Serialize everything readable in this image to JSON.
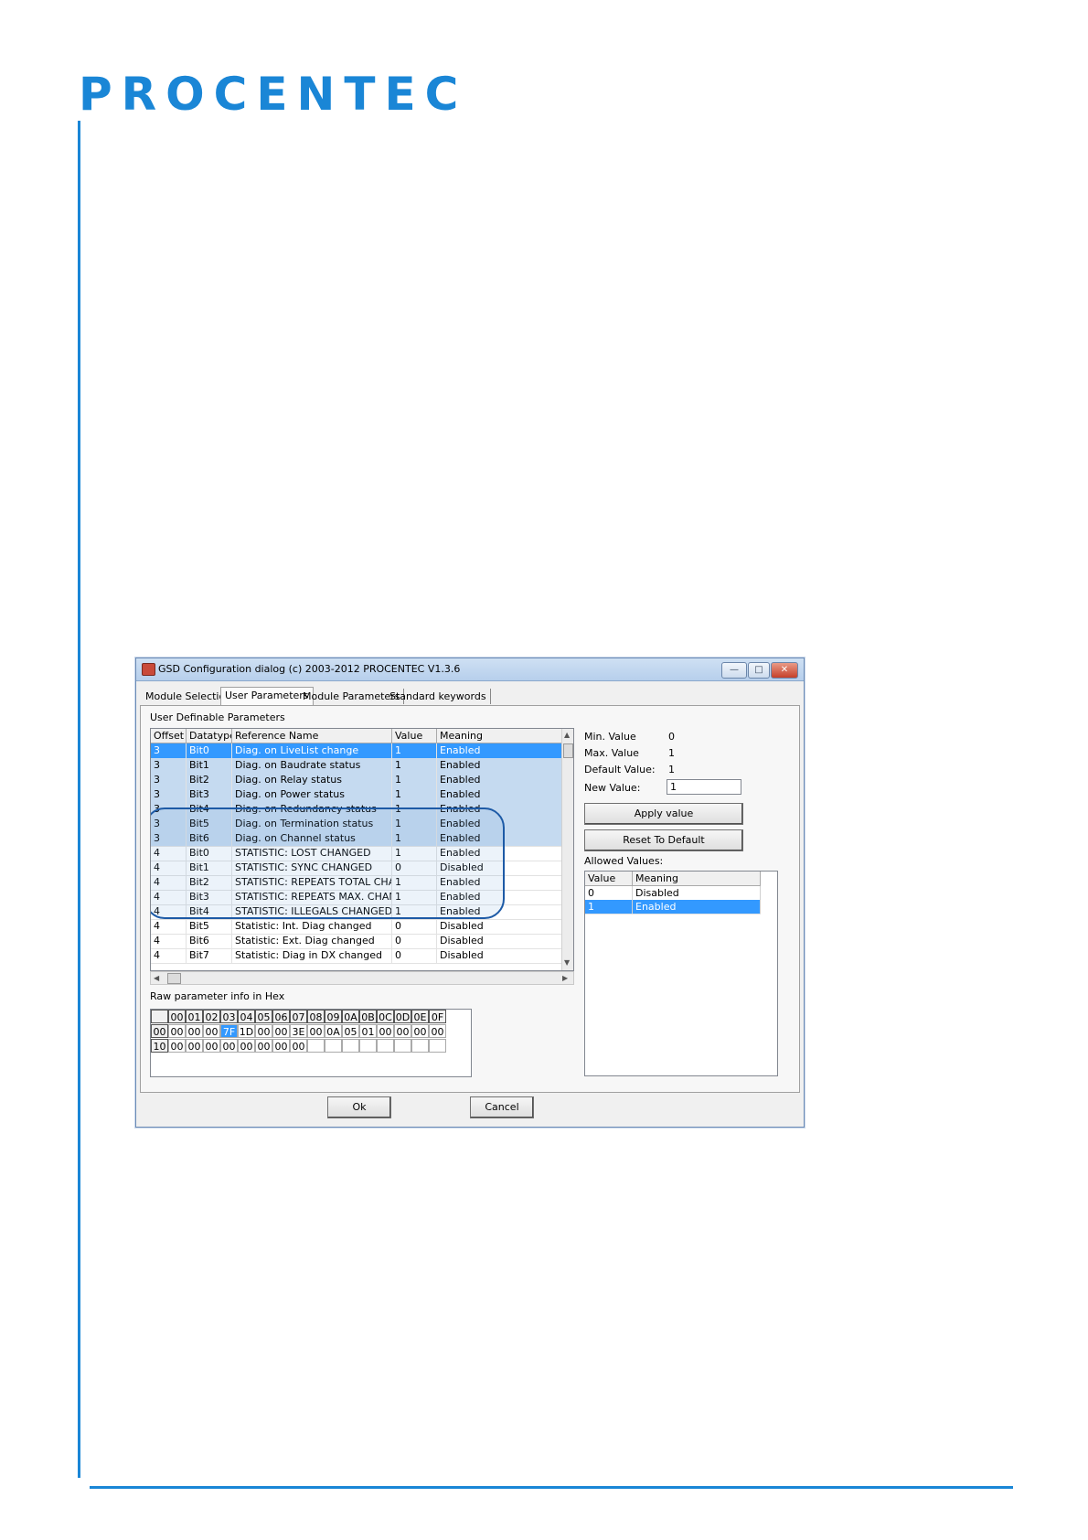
{
  "brand": {
    "logo_text": "PROCENTEC",
    "accent_color": "#1a86d6"
  },
  "dialog": {
    "title": "GSD Configuration dialog (c) 2003-2012 PROCENTEC V1.3.6",
    "window_buttons": {
      "minimize": "—",
      "maximize": "□",
      "close": "✕"
    },
    "tabs": [
      "Module Selection",
      "User Parameters",
      "Module Parameters",
      "Standard keywords"
    ],
    "active_tab": "User Parameters",
    "udp_label": "User Definable Parameters",
    "columns": [
      "Offset",
      "Datatype",
      "Reference Name",
      "Value",
      "Meaning"
    ],
    "rows": [
      [
        "3",
        "Bit0",
        "Diag. on LiveList change",
        "1",
        "Enabled"
      ],
      [
        "3",
        "Bit1",
        "Diag. on Baudrate status",
        "1",
        "Enabled"
      ],
      [
        "3",
        "Bit2",
        "Diag. on Relay status",
        "1",
        "Enabled"
      ],
      [
        "3",
        "Bit3",
        "Diag. on Power status",
        "1",
        "Enabled"
      ],
      [
        "3",
        "Bit4",
        "Diag. on Redundancy status",
        "1",
        "Enabled"
      ],
      [
        "3",
        "Bit5",
        "Diag. on Termination status",
        "1",
        "Enabled"
      ],
      [
        "3",
        "Bit6",
        "Diag. on Channel status",
        "1",
        "Enabled"
      ],
      [
        "4",
        "Bit0",
        "STATISTIC: LOST CHANGED",
        "1",
        "Enabled"
      ],
      [
        "4",
        "Bit1",
        "STATISTIC: SYNC CHANGED",
        "0",
        "Disabled"
      ],
      [
        "4",
        "Bit2",
        "STATISTIC: REPEATS TOTAL CHANI",
        "1",
        "Enabled"
      ],
      [
        "4",
        "Bit3",
        "STATISTIC: REPEATS MAX. CHANGE",
        "1",
        "Enabled"
      ],
      [
        "4",
        "Bit4",
        "STATISTIC: ILLEGALS CHANGED",
        "1",
        "Enabled"
      ],
      [
        "4",
        "Bit5",
        "Statistic: Int. Diag changed",
        "0",
        "Disabled"
      ],
      [
        "4",
        "Bit6",
        "Statistic: Ext. Diag changed",
        "0",
        "Disabled"
      ],
      [
        "4",
        "Bit7",
        "Statistic: Diag in DX changed",
        "0",
        "Disabled"
      ]
    ],
    "selected_row": 0,
    "raw_label": "Raw parameter info in Hex",
    "hex_header": [
      "00",
      "01",
      "02",
      "03",
      "04",
      "05",
      "06",
      "07",
      "08",
      "09",
      "0A",
      "0B",
      "0C",
      "0D",
      "0E",
      "0F"
    ],
    "hex_rows": [
      {
        "addr": "00",
        "values": [
          "00",
          "00",
          "00",
          "7F",
          "1D",
          "00",
          "00",
          "3E",
          "00",
          "0A",
          "05",
          "01",
          "00",
          "00",
          "00",
          "00"
        ]
      },
      {
        "addr": "10",
        "values": [
          "00",
          "00",
          "00",
          "00",
          "00",
          "00",
          "00",
          "00"
        ]
      }
    ],
    "hex_selected": "7F",
    "min_label": "Min. Value",
    "min_value": "0",
    "max_label": "Max. Value",
    "max_value": "1",
    "default_label": "Default Value:",
    "default_value": "1",
    "new_label": "New Value:",
    "new_value": "1",
    "apply_label": "Apply value",
    "reset_label": "Reset To Default",
    "allowed_label": "Allowed Values:",
    "allowed_columns": [
      "Value",
      "Meaning"
    ],
    "allowed_rows": [
      [
        "0",
        "Disabled"
      ],
      [
        "1",
        "Enabled"
      ]
    ],
    "ok_label": "Ok",
    "cancel_label": "Cancel"
  }
}
